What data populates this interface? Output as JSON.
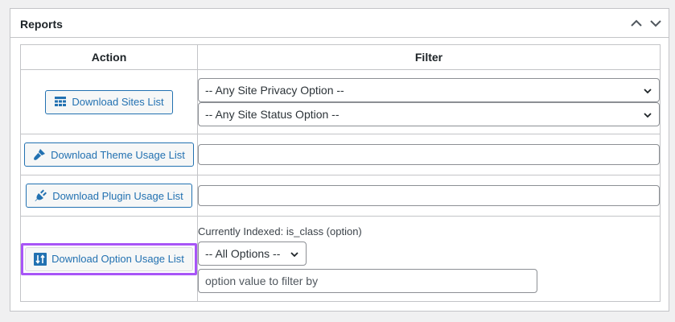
{
  "panel": {
    "title": "Reports"
  },
  "table": {
    "action_header": "Action",
    "filter_header": "Filter"
  },
  "rows": [
    {
      "button_label": "Download Sites List",
      "icon": "table-grid-icon",
      "filters": {
        "privacy_select": "-- Any Site Privacy Option --",
        "status_select": "-- Any Site Status Option --"
      }
    },
    {
      "button_label": "Download Theme Usage List",
      "icon": "paintbrush-icon",
      "filter_value": ""
    },
    {
      "button_label": "Download Plugin Usage List",
      "icon": "plugin-icon",
      "filter_value": ""
    },
    {
      "button_label": "Download Option Usage List",
      "icon": "sort-icon",
      "indexed_text": "Currently Indexed: is_class (option)",
      "options_select": "-- All Options --",
      "option_value_placeholder": "option value to filter by"
    }
  ],
  "colors": {
    "accent": "#2271b1",
    "highlight": "#a855f7",
    "border": "#c3c4c7"
  }
}
